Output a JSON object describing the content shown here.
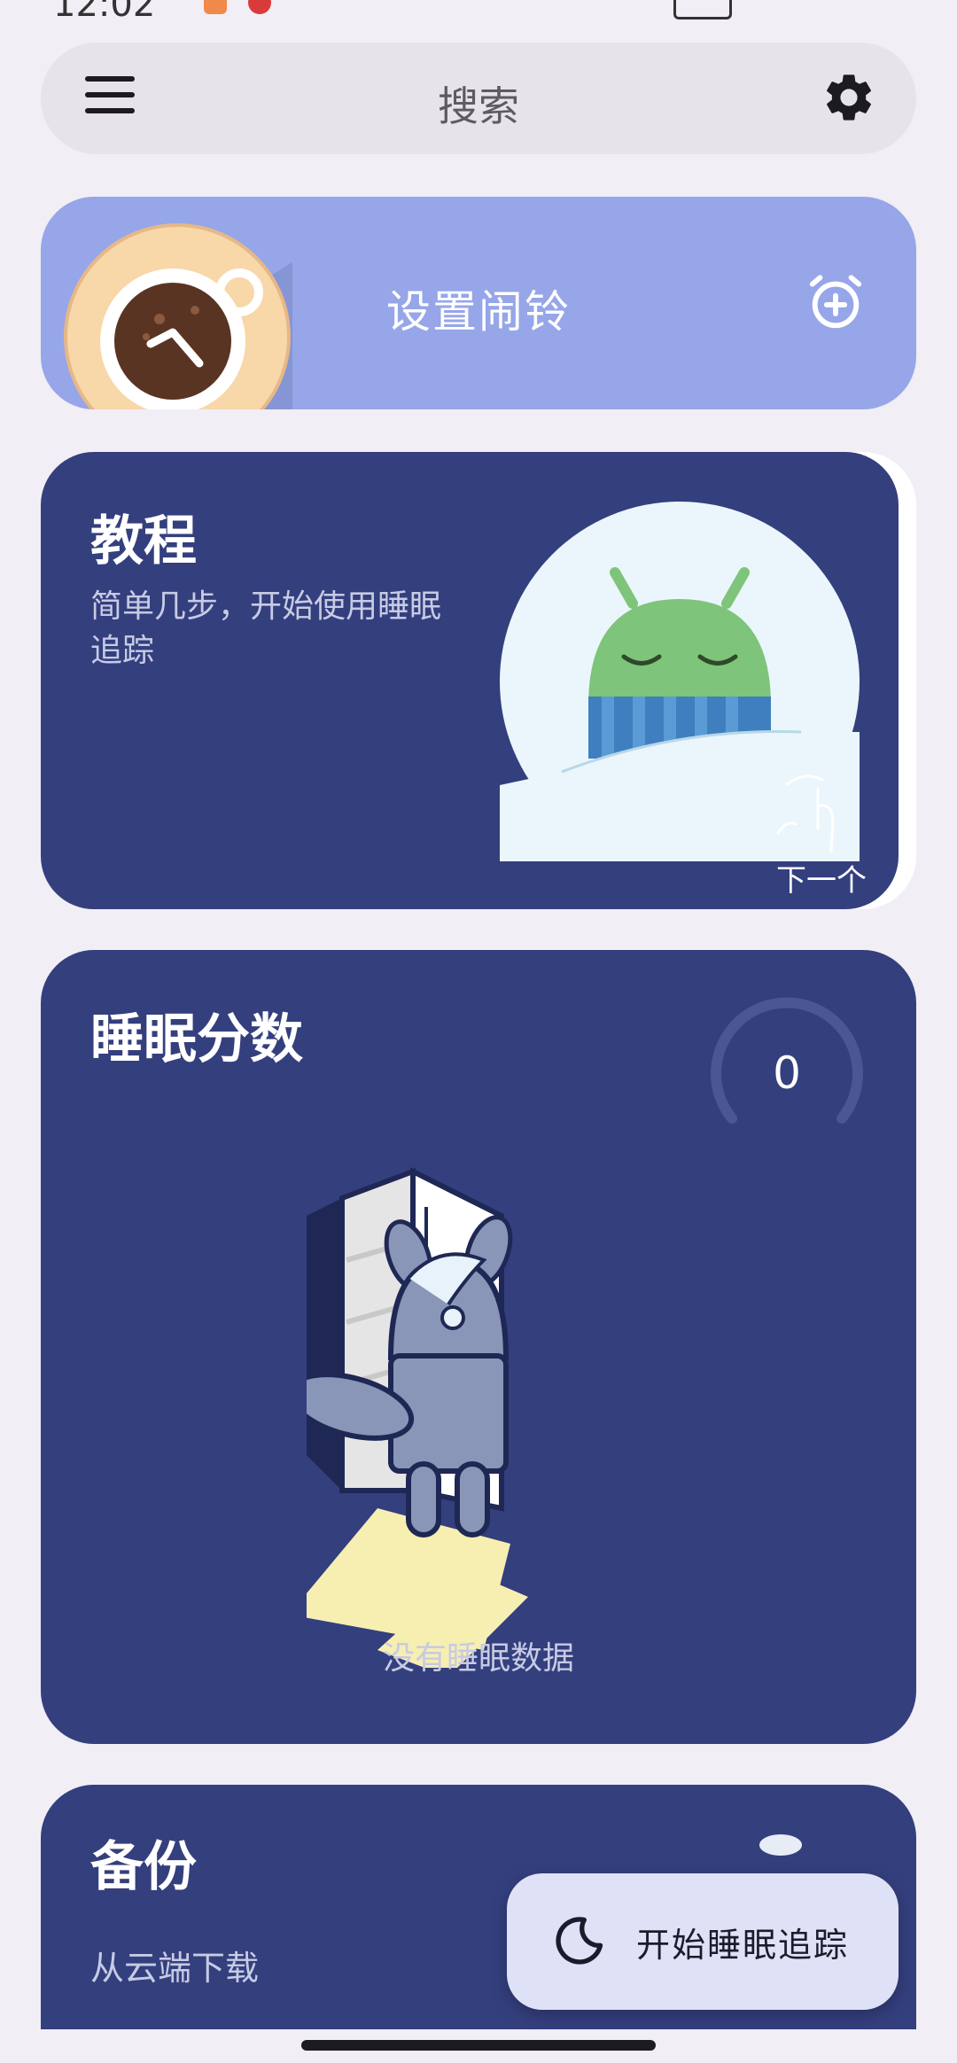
{
  "status_bar": {
    "time": "12:02"
  },
  "search": {
    "placeholder": "搜索"
  },
  "alarm_card": {
    "title": "设置闹铃"
  },
  "tutorial_card": {
    "title": "教程",
    "description": "简单几步，开始使用睡眠追踪",
    "next_label": "下一个"
  },
  "sleep_score_card": {
    "title": "睡眠分数",
    "score": "0",
    "empty_text": "没有睡眠数据"
  },
  "backup_card": {
    "title": "备份",
    "subtitle": "从云端下载"
  },
  "fab": {
    "label": "开始睡眠追踪"
  },
  "colors": {
    "background": "#f1eef5",
    "card_dark": "#343f7e",
    "alarm_card": "#96a6e8",
    "fab": "#dfe1f6",
    "bot_green": "#7ec47b"
  }
}
